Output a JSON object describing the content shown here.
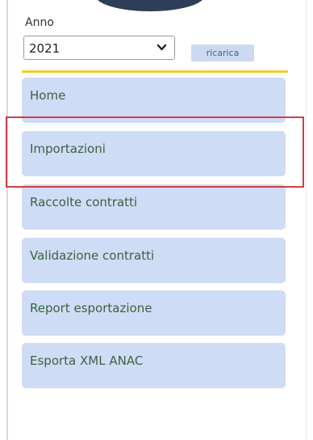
{
  "filter": {
    "label": "Anno",
    "selected_year": "2021",
    "reload_label": "ricarica"
  },
  "menu": {
    "items": [
      {
        "label": "Home"
      },
      {
        "label": "Importazioni"
      },
      {
        "label": "Raccolte contratti"
      },
      {
        "label": "Validazione contratti"
      },
      {
        "label": "Report esportazione"
      },
      {
        "label": "Esporta XML ANAC"
      }
    ]
  },
  "colors": {
    "menu_item_bg": "#cfdcf6",
    "menu_text": "#3a6340",
    "accent_line": "#f2cd2a",
    "highlight_border": "#cf3f45",
    "reload_bg": "#cdd9f0",
    "top_shape": "#2c3e58"
  },
  "icons": {
    "select_arrow": "chevron-down-icon"
  }
}
